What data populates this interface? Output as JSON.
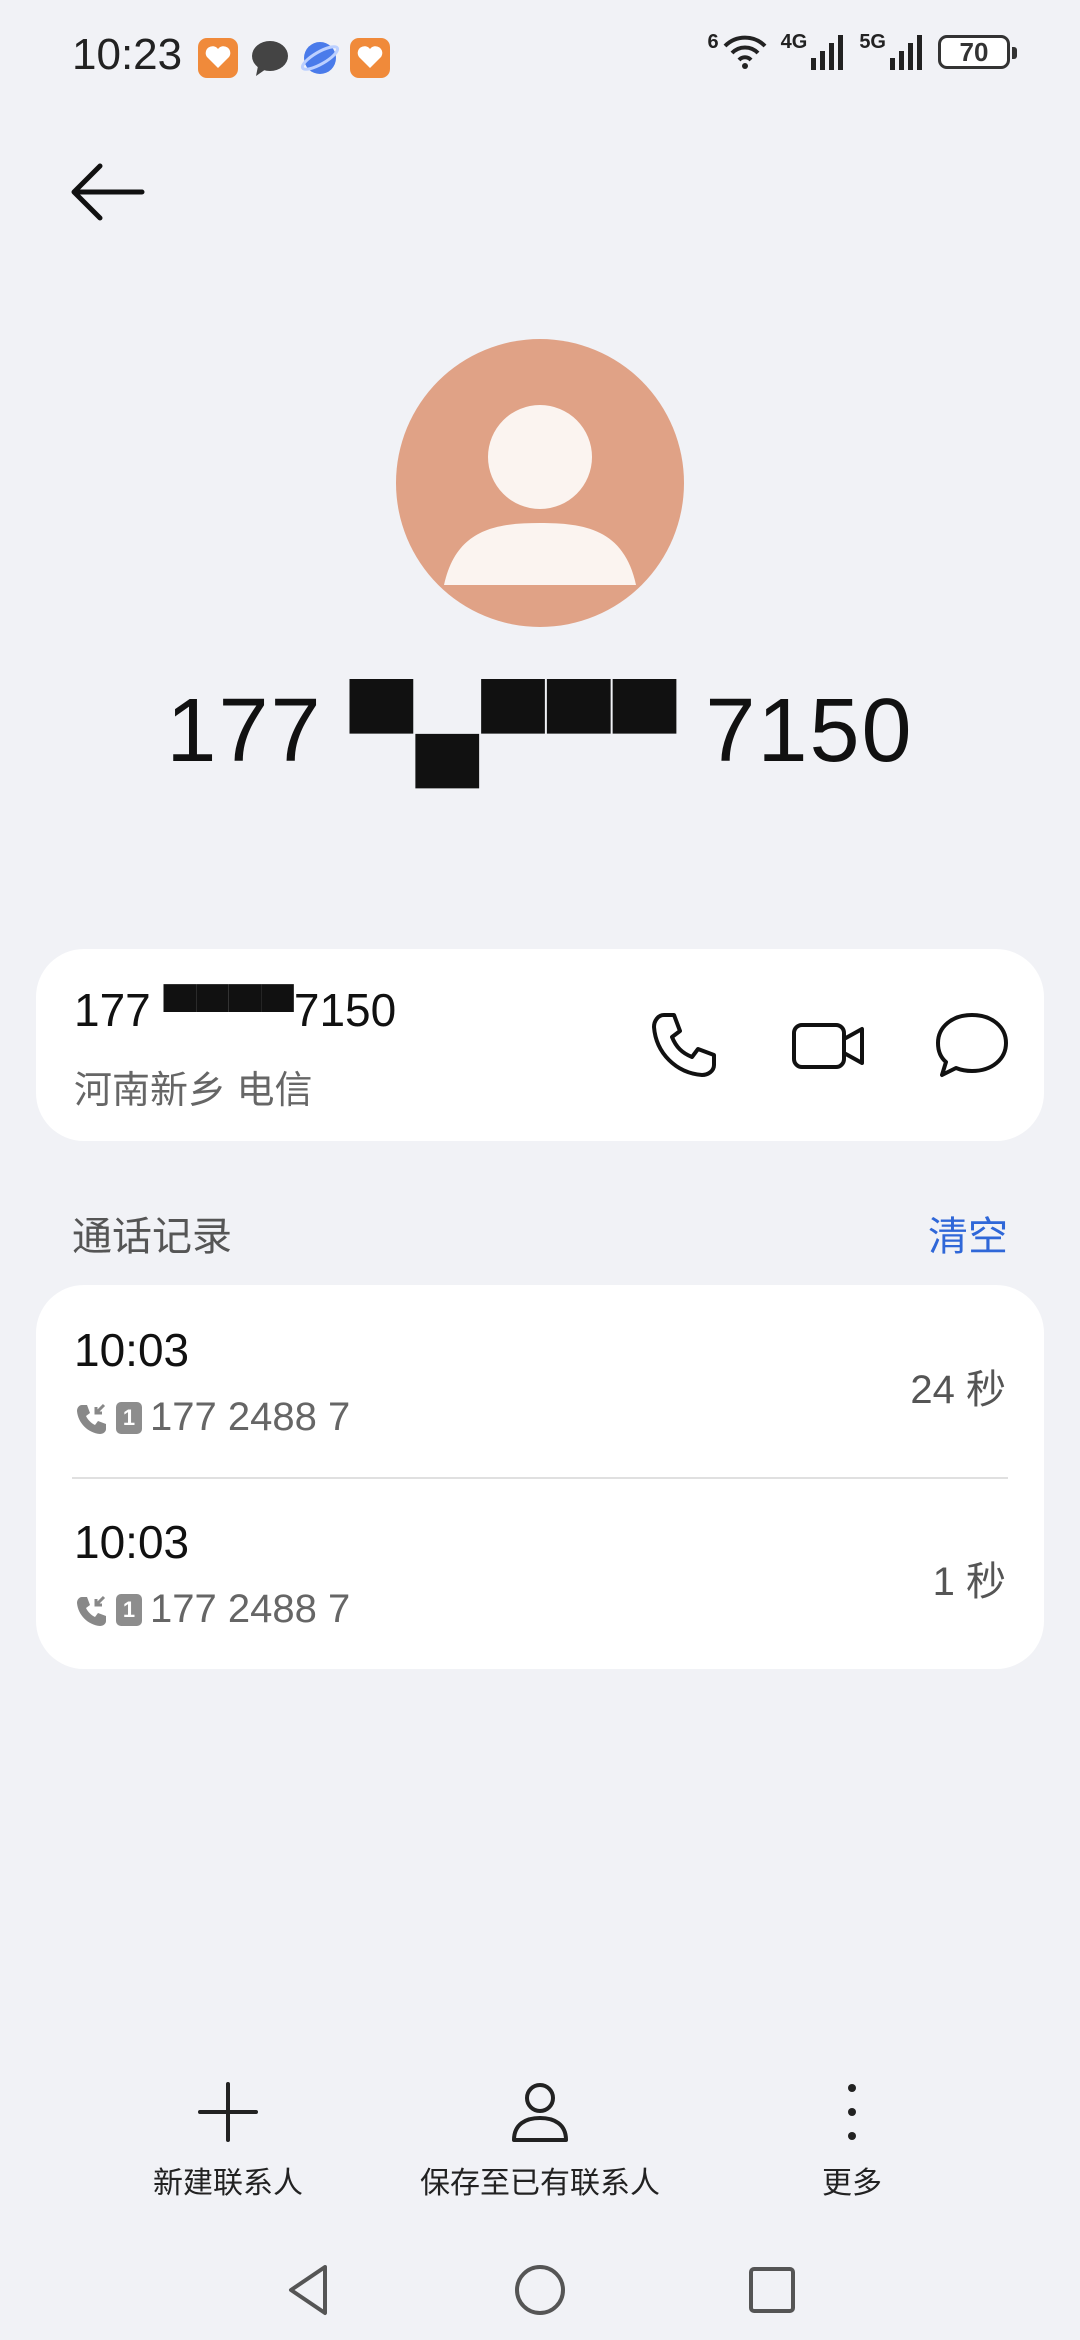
{
  "status_bar": {
    "time": "10:23",
    "notifications": [
      "app-icon-orange-heart",
      "chat-bubble-icon",
      "browser-planet-icon",
      "app-icon-orange-heart"
    ],
    "wifi_label": "6",
    "net1": "4G",
    "net2": "5G",
    "battery": "70"
  },
  "header": {
    "back_icon": "arrow-left-icon"
  },
  "contact": {
    "display_number": "177 ▀▄▀▀▀ 7150",
    "avatar_color": "#e0a286"
  },
  "number_card": {
    "number": "177 ▀▀▀▀7150",
    "location": "河南新乡 电信",
    "actions": [
      "phone-icon",
      "video-icon",
      "message-icon"
    ]
  },
  "call_log": {
    "title": "通话记录",
    "clear_label": "清空",
    "entries": [
      {
        "time": "10:03",
        "sim": "1",
        "number": "177 2488 7",
        "duration": "24 秒"
      },
      {
        "time": "10:03",
        "sim": "1",
        "number": "177 2488 7",
        "duration": "1 秒"
      }
    ]
  },
  "bottom_bar": {
    "new_contact": "新建联系人",
    "save_existing": "保存至已有联系人",
    "more": "更多"
  },
  "accent_color": "#2f67d8"
}
